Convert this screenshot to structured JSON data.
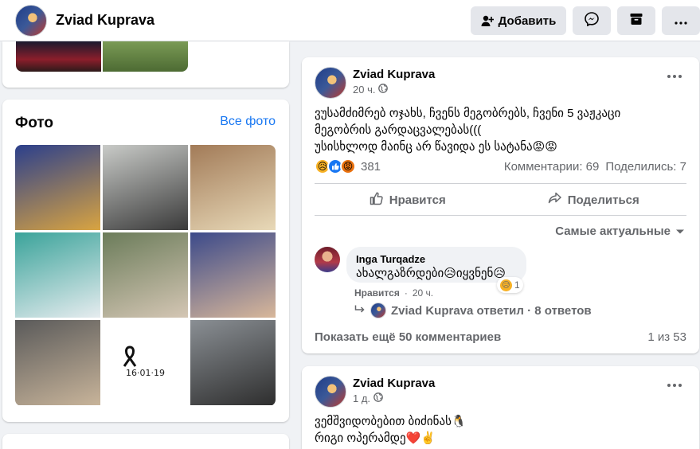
{
  "header": {
    "profile_name": "Zviad Kuprava",
    "add_label": "Добавить",
    "messenger_icon": "messenger-icon",
    "archive_icon": "archive-icon",
    "more_icon": "more-horizontal-icon"
  },
  "photos": {
    "title": "Фото",
    "see_all": "Все фото",
    "tiles": [
      {
        "colors": [
          "#2b3f8c",
          "#d9a441"
        ]
      },
      {
        "colors": [
          "#c9cbc8",
          "#3a3a3a"
        ]
      },
      {
        "colors": [
          "#a27b58",
          "#e8d9b8"
        ]
      },
      {
        "colors": [
          "#3aa39a",
          "#e6ecef"
        ]
      },
      {
        "colors": [
          "#6b7c5a",
          "#d4c6b4"
        ]
      },
      {
        "colors": [
          "#3c4a8a",
          "#d8b79a"
        ]
      },
      {
        "colors": [
          "#5a5a5a",
          "#c8b49a"
        ]
      },
      {
        "colors": [
          "#ffffff",
          "#222222"
        ]
      },
      {
        "colors": [
          "#8a8f94",
          "#2e2e2e"
        ]
      }
    ],
    "memorial_text": "16·01·19"
  },
  "post1": {
    "author": "Zviad Kuprava",
    "time": "20 ч.",
    "text": "ვუსამძიმრებ ოჯახს, ჩვენს მეგობრებს, ჩვენი 5 ვაჟკაცი\nმეგობრის გარდაცვალებას(((\nუსისხლოდ მაინც არ წავიდა ეს სატანა😡😡",
    "reaction_count": "381",
    "comments": "Комментарии: 69",
    "shares": "Поделились: 7",
    "like_label": "Нравится",
    "share_label": "Поделиться",
    "sort_label": "Самые актуальные",
    "comment": {
      "author": "Inga Turqadze",
      "text": "ახალგაზრდები😥იყვნენ😥",
      "reaction_count": "1",
      "like": "Нравится",
      "time": "20 ч."
    },
    "reply_summary": "Zviad Kuprava ответил · 8 ответов",
    "more_comments": "Показать ещё 50 комментариев",
    "page_count": "1 из 53"
  },
  "post2": {
    "author": "Zviad Kuprava",
    "time": "1 д.",
    "text": "ვემშვიდობებით ბიძინას🐧\nრიგი ოპერამდე❤️✌️"
  }
}
